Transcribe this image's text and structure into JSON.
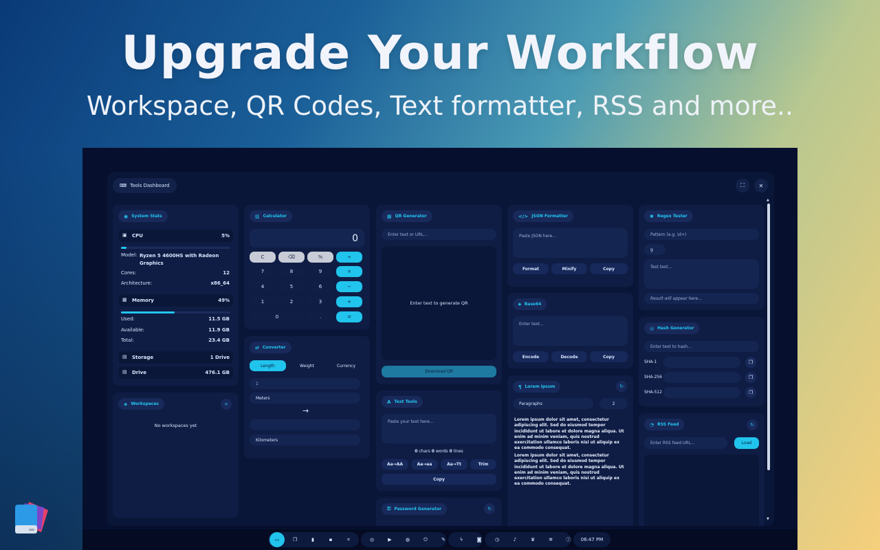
{
  "hero": {
    "title": "Upgrade Your Workflow",
    "subtitle": "Workspace, QR Codes, Text formatter, RSS and more.."
  },
  "colors": {
    "accent": "#22c6f0",
    "card": "#0f1d45",
    "window": "#0a1638"
  },
  "window": {
    "title": "Tools Dashboard",
    "title_icon": "keyboard-icon"
  },
  "system_stats": {
    "title": "System Stats",
    "cpu": {
      "label": "CPU",
      "percent": "5%",
      "usage_fraction": 0.05,
      "model_label": "Model:",
      "model": "Ryzen 5 4600HS with Radeon Graphics",
      "cores_label": "Cores:",
      "cores": "12",
      "arch_label": "Architecture:",
      "arch": "x86_64"
    },
    "memory": {
      "label": "Memory",
      "percent": "49%",
      "usage_fraction": 0.49,
      "used_label": "Used:",
      "used": "11.5 GB",
      "available_label": "Available:",
      "available": "11.9 GB",
      "total_label": "Total:",
      "total": "23.4 GB"
    },
    "storage": {
      "label": "Storage",
      "value": "1 Drive",
      "drive_label": "Drive",
      "drive_value": "476.1 GB"
    }
  },
  "workspaces": {
    "title": "Workspaces",
    "empty": "No workspaces yet",
    "add": "+"
  },
  "calculator": {
    "title": "Calculator",
    "display": "0",
    "keys": [
      "C",
      "⌫",
      "%",
      "÷",
      "7",
      "8",
      "9",
      "×",
      "4",
      "5",
      "6",
      "−",
      "1",
      "2",
      "3",
      "+",
      "0",
      ".",
      "="
    ]
  },
  "converter": {
    "title": "Converter",
    "tabs": [
      "Length",
      "Weight",
      "Currency"
    ],
    "input_value": "1",
    "from_unit": "Meters",
    "arrow": "→",
    "result": "",
    "to_unit": "Kilometers"
  },
  "qr": {
    "title": "QR Generator",
    "placeholder": "Enter text or URL...",
    "preview_text": "Enter text to generate QR",
    "download": "Download QR"
  },
  "text_tools": {
    "title": "Text Tools",
    "placeholder": "Paste your text here...",
    "chars_count": "0",
    "chars_label": "chars",
    "words_count": "0",
    "words_label": "words",
    "lines_count": "0",
    "lines_label": "lines",
    "buttons": [
      "Aa→AA",
      "Aa→aa",
      "Aa→Tt",
      "Trim"
    ],
    "copy": "Copy"
  },
  "password": {
    "title": "Password Generator"
  },
  "json_formatter": {
    "title": "JSON Formatter",
    "placeholder": "Paste JSON here...",
    "buttons": [
      "Format",
      "Minify",
      "Copy"
    ]
  },
  "base64": {
    "title": "Base64",
    "placeholder": "Enter text...",
    "buttons": [
      "Encode",
      "Decode",
      "Copy"
    ]
  },
  "lorem": {
    "title": "Lorem Ipsum",
    "type": "Paragraphs",
    "count": "2",
    "paragraphs": [
      "Lorem ipsum dolor sit amet, consectetur adipiscing elit. Sed do eiusmod tempor incididunt ut labore et dolore magna aliqua. Ut enim ad minim veniam, quis nostrud exercitation ullamco laboris nisi ut aliquip ex ea commodo consequat.",
      "Lorem ipsum dolor sit amet, consectetur adipiscing elit. Sed do eiusmod tempor incididunt ut labore et dolore magna aliqua. Ut enim ad minim veniam, quis nostrud exercitation ullamco laboris nisi ut aliquip ex ea commodo consequat."
    ]
  },
  "regex": {
    "title": "Regex Tester",
    "pattern_placeholder": "Pattern (e.g. \\d+)",
    "flags": "g",
    "test_placeholder": "Test text...",
    "result_placeholder": "Result will appear here..."
  },
  "hash": {
    "title": "Hash Generator",
    "placeholder": "Enter text to hash...",
    "rows": [
      "SHA-1",
      "SHA-256",
      "SHA-512"
    ]
  },
  "rss": {
    "title": "RSS Feed",
    "placeholder": "Enter RSS feed URL...",
    "load": "Load"
  },
  "taskbar": {
    "icons": [
      "dashboard-icon",
      "copy-icon",
      "bookmark-icon",
      "note-icon",
      "qr-scan-icon",
      "chrome-icon",
      "youtube-icon",
      "github-icon",
      "power-icon",
      "edit-icon",
      "bolt-icon",
      "camera-icon",
      "clock-icon",
      "bell-icon",
      "crown-icon",
      "settings-icon",
      "info-icon"
    ],
    "time": "06:47 PM"
  }
}
